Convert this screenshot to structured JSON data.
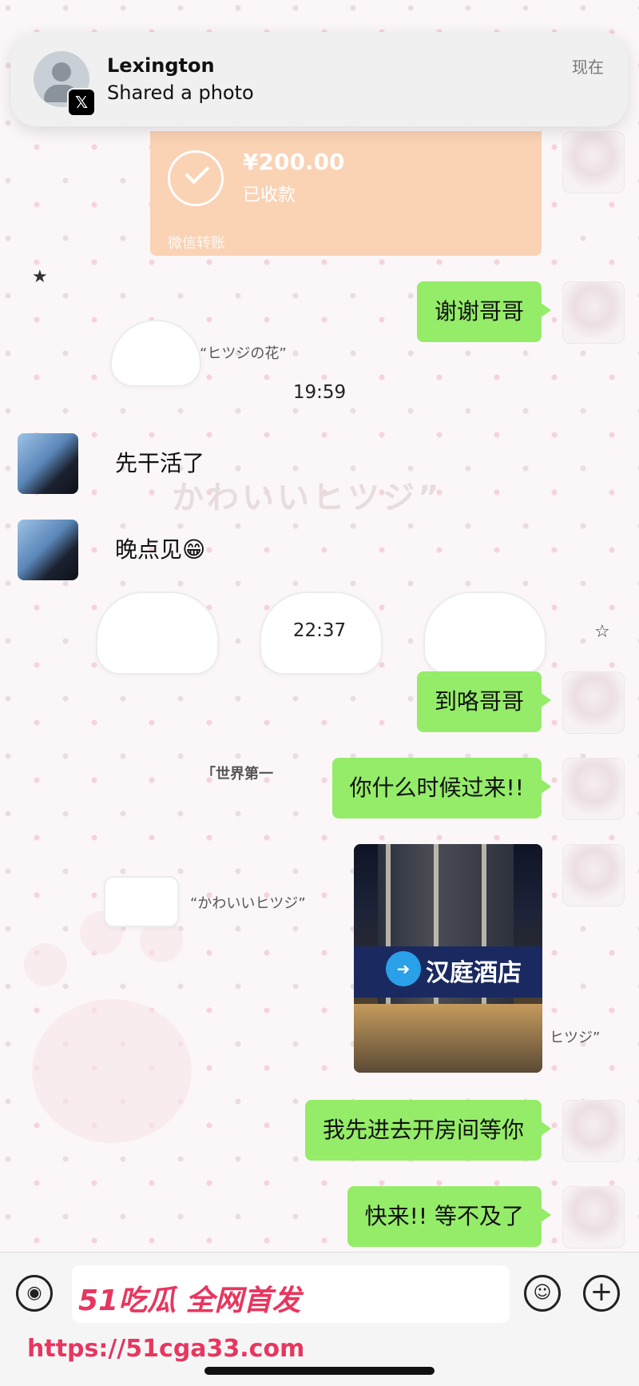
{
  "notification": {
    "name": "Lexington",
    "message": "Shared a photo",
    "time": "现在",
    "badge_icon": "x-logo-icon"
  },
  "transfer": {
    "amount": "¥200.00",
    "status": "已收款",
    "footer": "微信转账",
    "color": "#fad2b4"
  },
  "wallpaper": {
    "sticker_1": "“ヒツジの花”",
    "sticker_2": "かわいいヒツジ”",
    "sticker_3": "「世界第一",
    "sticker_4": "“かわいいヒツジ”",
    "sticker_5": "ヒツジ”"
  },
  "messages": [
    {
      "side": "right",
      "text": "谢谢哥哥"
    },
    {
      "side": "left",
      "text": "先干活了"
    },
    {
      "side": "left",
      "text": "晚点见😁"
    },
    {
      "side": "right",
      "text": "到咯哥哥"
    },
    {
      "side": "right",
      "text": "你什么时候过来!!"
    },
    {
      "side": "right",
      "type": "photo",
      "sign_text": "汉庭酒店"
    },
    {
      "side": "right",
      "text": "我先进去开房间等你"
    },
    {
      "side": "right",
      "text": "快来!!  等不及了"
    }
  ],
  "timestamps": [
    "19:59",
    "22:37"
  ],
  "input_bar": {
    "voice_icon": "voice-icon",
    "emoji_icon": "emoji-icon",
    "plus_icon": "plus-icon"
  },
  "watermark": {
    "line1": "51吃瓜 全网首发",
    "line2": "https://51cga33.com"
  },
  "colors": {
    "bubble_green": "#95ec69",
    "watermark": "#e8365f"
  }
}
